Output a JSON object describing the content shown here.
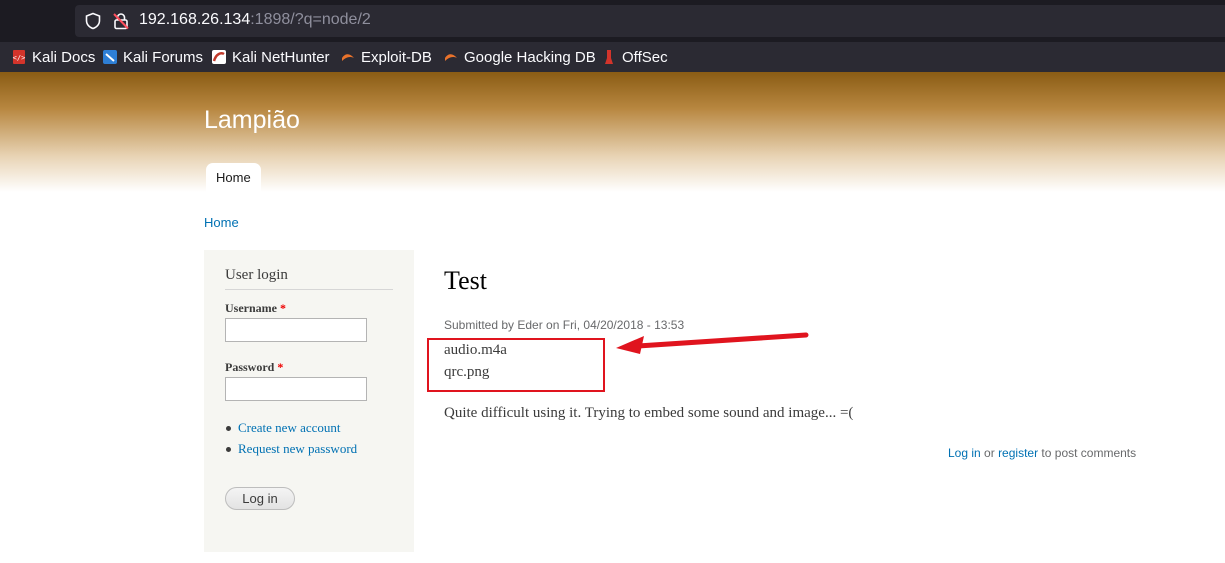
{
  "browser": {
    "url_host": "192.168.26.134",
    "url_rest": ":1898/?q=node/2",
    "bookmarks": [
      {
        "label": "Kali Docs",
        "icon": "kali-docs-icon",
        "color": "#d3342b"
      },
      {
        "label": "Kali Forums",
        "icon": "kali-forums-icon",
        "color": "#2e7fd6"
      },
      {
        "label": "Kali NetHunter",
        "icon": "kali-nethunter-icon",
        "color": "#c0392b"
      },
      {
        "label": "Exploit-DB",
        "icon": "exploit-db-icon",
        "color": "#e9722b"
      },
      {
        "label": "Google Hacking DB",
        "icon": "ghdb-icon",
        "color": "#e9722b"
      },
      {
        "label": "OffSec",
        "icon": "offsec-icon",
        "color": "#d3342b"
      }
    ]
  },
  "site": {
    "name": "Lampião",
    "nav_home": "Home",
    "breadcrumb_home": "Home"
  },
  "login": {
    "title": "User login",
    "username_label": "Username",
    "password_label": "Password",
    "required_marker": "*",
    "create_account": "Create new account",
    "request_password": "Request new password",
    "submit": "Log in"
  },
  "node": {
    "title": "Test",
    "submitted": "Submitted by Eder on Fri, 04/20/2018 - 13:53",
    "file1": "audio.m4a",
    "file2": "qrc.png",
    "body": "Quite difficult using it. Trying to embed some sound and image... =(",
    "comment_login": "Log in",
    "comment_or": "or",
    "comment_register": "register",
    "comment_suffix": "to post comments"
  },
  "colors": {
    "link": "#0071b3",
    "annotation": "#e0141e",
    "header_brown": "#8a5c14"
  }
}
